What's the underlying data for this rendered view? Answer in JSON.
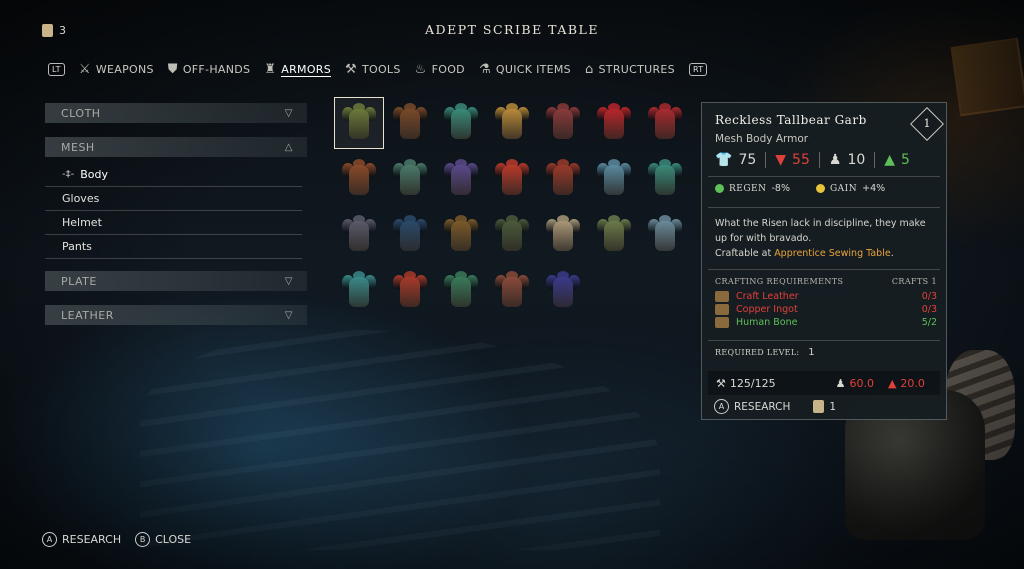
{
  "header": {
    "title": "ADEPT SCRIBE TABLE",
    "scroll_count": "3"
  },
  "categories": [
    {
      "label": "WEAPONS",
      "glyph": "⚔",
      "icon": "weapons-icon",
      "active": false
    },
    {
      "label": "OFF-HANDS",
      "glyph": "⛊",
      "icon": "shield-icon",
      "active": false
    },
    {
      "label": "ARMORS",
      "glyph": "♜",
      "icon": "armor-icon",
      "active": true
    },
    {
      "label": "TOOLS",
      "glyph": "⚒",
      "icon": "tools-icon",
      "active": false
    },
    {
      "label": "FOOD",
      "glyph": "♨",
      "icon": "food-icon",
      "active": false
    },
    {
      "label": "QUICK ITEMS",
      "glyph": "⚗",
      "icon": "quick-items-icon",
      "active": false
    },
    {
      "label": "STRUCTURES",
      "glyph": "⌂",
      "icon": "structures-icon",
      "active": false
    }
  ],
  "bumpers": {
    "left": "LT",
    "right": "RT"
  },
  "sidebar": {
    "cloth": "CLOTH",
    "mesh": "MESH",
    "mesh_items": [
      "Body",
      "Gloves",
      "Helmet",
      "Pants"
    ],
    "plate": "PLATE",
    "leather": "LEATHER"
  },
  "grid_colors": [
    [
      "#6b7a3a",
      "#7a4a2a",
      "#3a8a7a",
      "#b88a3a",
      "#8a3a3a",
      "#b8262a",
      "#a82a2e"
    ],
    [
      "#8a4a2a",
      "#4a7a6a",
      "#5a4a8a",
      "#b83a2a",
      "#9a3a2a",
      "#5a8aa0",
      "#3a8a7a"
    ],
    [
      "#5a5a6a",
      "#2a4a6a",
      "#7a5a2a",
      "#4a5a3a",
      "#a89878",
      "#6a7a4a",
      "#6a8a9a"
    ],
    [
      "#3a8a8a",
      "#a83a2a",
      "#3a7a5a",
      "#8a4a3a",
      "#3a3a8a"
    ]
  ],
  "tooltip": {
    "name": "Reckless Tallbear Garb",
    "type": "Mesh Body Armor",
    "tier": "1",
    "stats": {
      "defense": "75",
      "defense_change": "55",
      "weight": "10",
      "weight_change": "5"
    },
    "perks": [
      {
        "label": "REGEN",
        "value": "-8%",
        "color": "#5fbf59"
      },
      {
        "label": "GAIN",
        "value": "+4%",
        "color": "#e8c23a"
      }
    ],
    "description": "What the Risen lack in discipline, they make up for with bravado.",
    "craftable_prefix": "Craftable at ",
    "craftable_at": "Apprentice Sewing Table",
    "crafting_header": "CRAFTING REQUIREMENTS",
    "crafts_label": "CRAFTS 1",
    "requirements": [
      {
        "name": "Craft Leather",
        "count": "0/3",
        "ok": false
      },
      {
        "name": "Copper Ingot",
        "count": "0/3",
        "ok": false
      },
      {
        "name": "Human Bone",
        "count": "5/2",
        "ok": true
      }
    ],
    "required_level_label": "REQUIRED LEVEL:",
    "required_level": "1",
    "durability": "125/125",
    "weight_value": "60.0",
    "weight_delta": "20.0",
    "research_label": "RESEARCH",
    "research_cost": "1"
  },
  "hints": [
    {
      "button": "A",
      "label": "RESEARCH"
    },
    {
      "button": "B",
      "label": "CLOSE"
    }
  ]
}
